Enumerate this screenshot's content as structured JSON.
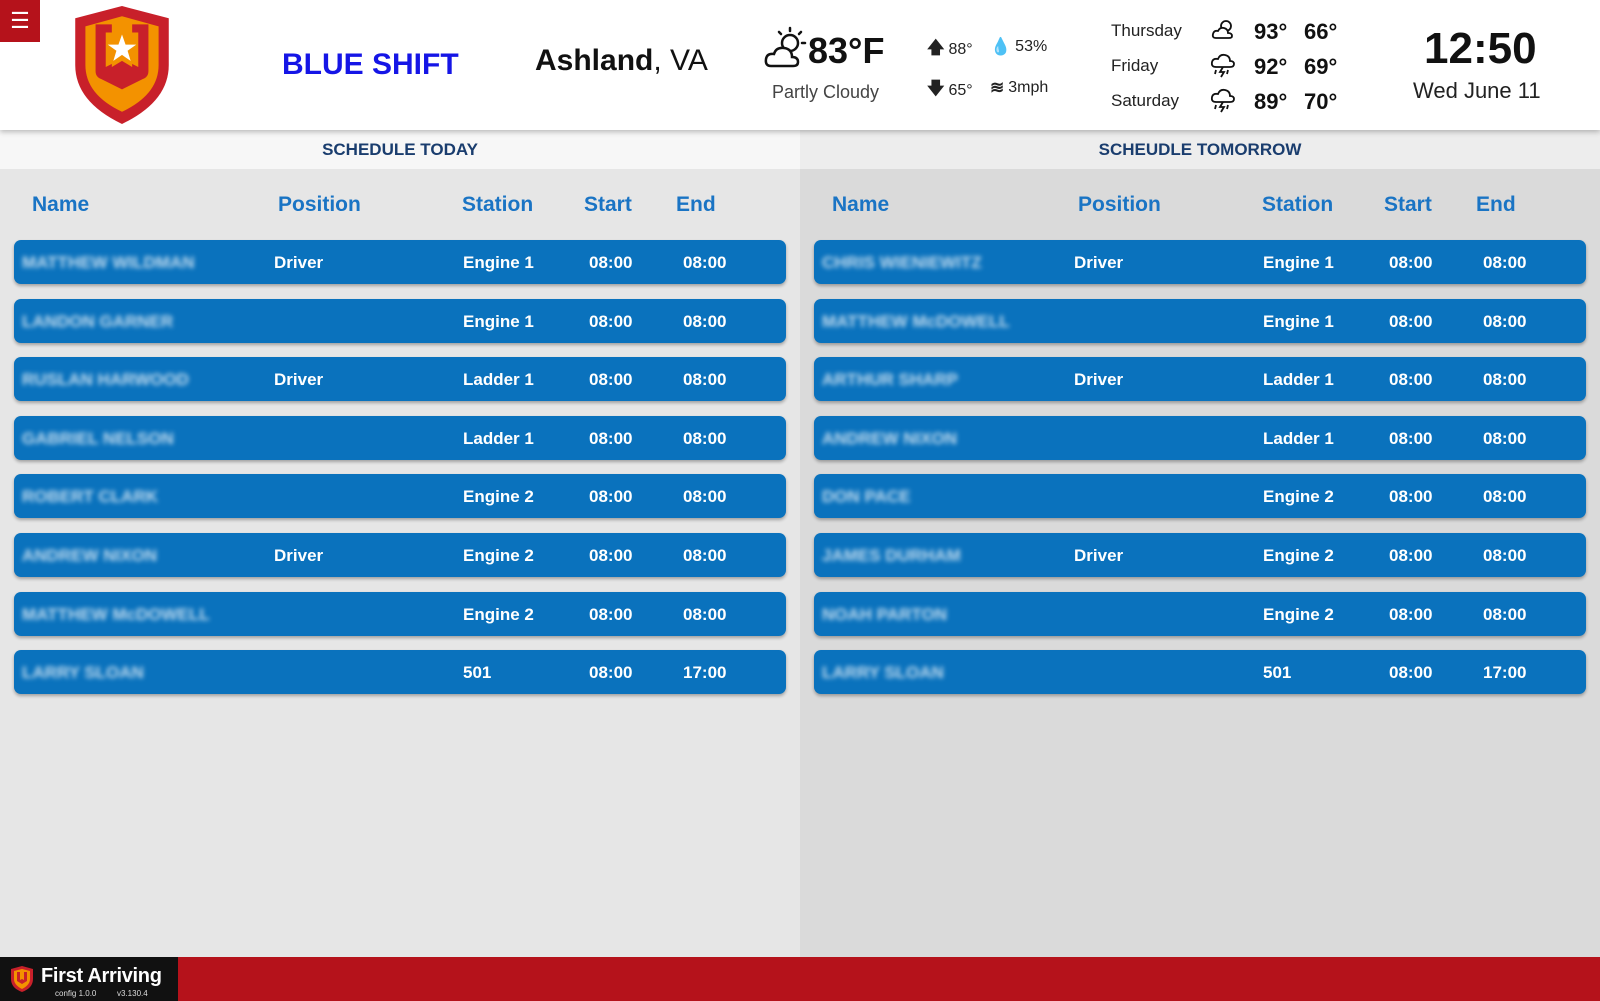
{
  "header": {
    "menu_icon": "hamburger-menu-icon",
    "shift_name": "BLUE SHIFT",
    "city": "Ashland",
    "state": ", VA",
    "current_temp": "83°F",
    "condition": "Partly Cloudy",
    "condition_icon": "partly-cloudy-sun-icon",
    "high": "88°",
    "low": "65°",
    "humidity": "53%",
    "wind": "3mph",
    "forecast": [
      {
        "day": "Thursday",
        "icon": "partly-cloudy-icon",
        "hi": "93°",
        "lo": "66°"
      },
      {
        "day": "Friday",
        "icon": "thunderstorm-icon",
        "hi": "92°",
        "lo": "69°"
      },
      {
        "day": "Saturday",
        "icon": "thunderstorm-icon",
        "hi": "89°",
        "lo": "70°"
      }
    ],
    "time": "12:50",
    "date": "Wed June 11"
  },
  "today": {
    "title": "SCHEDULE TODAY",
    "columns": {
      "name": "Name",
      "position": "Position",
      "station": "Station",
      "start": "Start",
      "end": "End"
    },
    "rows": [
      {
        "name": "MATTHEW WILDMAN",
        "position": "Driver",
        "station": "Engine 1",
        "start": "08:00",
        "end": "08:00"
      },
      {
        "name": "LANDON GARNER",
        "position": "",
        "station": "Engine 1",
        "start": "08:00",
        "end": "08:00"
      },
      {
        "name": "RUSLAN HARWOOD",
        "position": "Driver",
        "station": "Ladder 1",
        "start": "08:00",
        "end": "08:00"
      },
      {
        "name": "GABRIEL NELSON",
        "position": "",
        "station": "Ladder 1",
        "start": "08:00",
        "end": "08:00"
      },
      {
        "name": "ROBERT CLARK",
        "position": "",
        "station": "Engine 2",
        "start": "08:00",
        "end": "08:00"
      },
      {
        "name": "ANDREW NIXON",
        "position": "Driver",
        "station": "Engine 2",
        "start": "08:00",
        "end": "08:00"
      },
      {
        "name": "MATTHEW McDOWELL",
        "position": "",
        "station": "Engine 2",
        "start": "08:00",
        "end": "08:00"
      },
      {
        "name": "LARRY SLOAN",
        "position": "",
        "station": "501",
        "start": "08:00",
        "end": "17:00"
      }
    ]
  },
  "tomorrow": {
    "title": "SCHEUDLE TOMORROW",
    "columns": {
      "name": "Name",
      "position": "Position",
      "station": "Station",
      "start": "Start",
      "end": "End"
    },
    "rows": [
      {
        "name": "CHRIS WIENIEWITZ",
        "position": "Driver",
        "station": "Engine 1",
        "start": "08:00",
        "end": "08:00"
      },
      {
        "name": "MATTHEW McDOWELL",
        "position": "",
        "station": "Engine 1",
        "start": "08:00",
        "end": "08:00"
      },
      {
        "name": "ARTHUR SHARP",
        "position": "Driver",
        "station": "Ladder 1",
        "start": "08:00",
        "end": "08:00"
      },
      {
        "name": "ANDREW NIXON",
        "position": "",
        "station": "Ladder 1",
        "start": "08:00",
        "end": "08:00"
      },
      {
        "name": "DON PACE",
        "position": "",
        "station": "Engine 2",
        "start": "08:00",
        "end": "08:00"
      },
      {
        "name": "JAMES DURHAM",
        "position": "Driver",
        "station": "Engine 2",
        "start": "08:00",
        "end": "08:00"
      },
      {
        "name": "NOAH PARTON",
        "position": "",
        "station": "Engine 2",
        "start": "08:00",
        "end": "08:00"
      },
      {
        "name": "LARRY SLOAN",
        "position": "",
        "station": "501",
        "start": "08:00",
        "end": "17:00"
      }
    ]
  },
  "footer": {
    "brand": "First Arriving",
    "config_version": "config 1.0.0",
    "app_version": "v3.130.4"
  },
  "colors": {
    "accent_red": "#b5121b",
    "row_blue": "#0a72bd",
    "header_blue": "#1a74c4",
    "shift_blue": "#1515e6"
  }
}
